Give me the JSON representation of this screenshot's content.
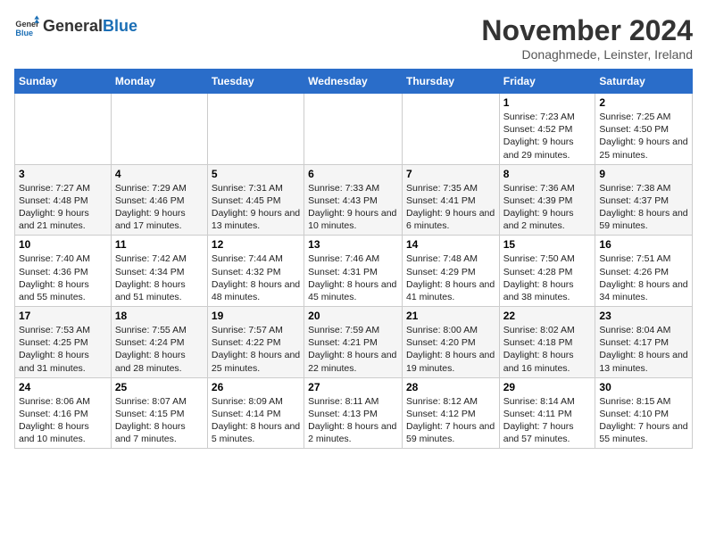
{
  "header": {
    "logo_general": "General",
    "logo_blue": "Blue",
    "month_title": "November 2024",
    "location": "Donaghmede, Leinster, Ireland"
  },
  "weekdays": [
    "Sunday",
    "Monday",
    "Tuesday",
    "Wednesday",
    "Thursday",
    "Friday",
    "Saturday"
  ],
  "weeks": [
    [
      {
        "day": "",
        "info": ""
      },
      {
        "day": "",
        "info": ""
      },
      {
        "day": "",
        "info": ""
      },
      {
        "day": "",
        "info": ""
      },
      {
        "day": "",
        "info": ""
      },
      {
        "day": "1",
        "info": "Sunrise: 7:23 AM\nSunset: 4:52 PM\nDaylight: 9 hours\nand 29 minutes."
      },
      {
        "day": "2",
        "info": "Sunrise: 7:25 AM\nSunset: 4:50 PM\nDaylight: 9 hours\nand 25 minutes."
      }
    ],
    [
      {
        "day": "3",
        "info": "Sunrise: 7:27 AM\nSunset: 4:48 PM\nDaylight: 9 hours\nand 21 minutes."
      },
      {
        "day": "4",
        "info": "Sunrise: 7:29 AM\nSunset: 4:46 PM\nDaylight: 9 hours\nand 17 minutes."
      },
      {
        "day": "5",
        "info": "Sunrise: 7:31 AM\nSunset: 4:45 PM\nDaylight: 9 hours\nand 13 minutes."
      },
      {
        "day": "6",
        "info": "Sunrise: 7:33 AM\nSunset: 4:43 PM\nDaylight: 9 hours\nand 10 minutes."
      },
      {
        "day": "7",
        "info": "Sunrise: 7:35 AM\nSunset: 4:41 PM\nDaylight: 9 hours\nand 6 minutes."
      },
      {
        "day": "8",
        "info": "Sunrise: 7:36 AM\nSunset: 4:39 PM\nDaylight: 9 hours\nand 2 minutes."
      },
      {
        "day": "9",
        "info": "Sunrise: 7:38 AM\nSunset: 4:37 PM\nDaylight: 8 hours\nand 59 minutes."
      }
    ],
    [
      {
        "day": "10",
        "info": "Sunrise: 7:40 AM\nSunset: 4:36 PM\nDaylight: 8 hours\nand 55 minutes."
      },
      {
        "day": "11",
        "info": "Sunrise: 7:42 AM\nSunset: 4:34 PM\nDaylight: 8 hours\nand 51 minutes."
      },
      {
        "day": "12",
        "info": "Sunrise: 7:44 AM\nSunset: 4:32 PM\nDaylight: 8 hours\nand 48 minutes."
      },
      {
        "day": "13",
        "info": "Sunrise: 7:46 AM\nSunset: 4:31 PM\nDaylight: 8 hours\nand 45 minutes."
      },
      {
        "day": "14",
        "info": "Sunrise: 7:48 AM\nSunset: 4:29 PM\nDaylight: 8 hours\nand 41 minutes."
      },
      {
        "day": "15",
        "info": "Sunrise: 7:50 AM\nSunset: 4:28 PM\nDaylight: 8 hours\nand 38 minutes."
      },
      {
        "day": "16",
        "info": "Sunrise: 7:51 AM\nSunset: 4:26 PM\nDaylight: 8 hours\nand 34 minutes."
      }
    ],
    [
      {
        "day": "17",
        "info": "Sunrise: 7:53 AM\nSunset: 4:25 PM\nDaylight: 8 hours\nand 31 minutes."
      },
      {
        "day": "18",
        "info": "Sunrise: 7:55 AM\nSunset: 4:24 PM\nDaylight: 8 hours\nand 28 minutes."
      },
      {
        "day": "19",
        "info": "Sunrise: 7:57 AM\nSunset: 4:22 PM\nDaylight: 8 hours\nand 25 minutes."
      },
      {
        "day": "20",
        "info": "Sunrise: 7:59 AM\nSunset: 4:21 PM\nDaylight: 8 hours\nand 22 minutes."
      },
      {
        "day": "21",
        "info": "Sunrise: 8:00 AM\nSunset: 4:20 PM\nDaylight: 8 hours\nand 19 minutes."
      },
      {
        "day": "22",
        "info": "Sunrise: 8:02 AM\nSunset: 4:18 PM\nDaylight: 8 hours\nand 16 minutes."
      },
      {
        "day": "23",
        "info": "Sunrise: 8:04 AM\nSunset: 4:17 PM\nDaylight: 8 hours\nand 13 minutes."
      }
    ],
    [
      {
        "day": "24",
        "info": "Sunrise: 8:06 AM\nSunset: 4:16 PM\nDaylight: 8 hours\nand 10 minutes."
      },
      {
        "day": "25",
        "info": "Sunrise: 8:07 AM\nSunset: 4:15 PM\nDaylight: 8 hours\nand 7 minutes."
      },
      {
        "day": "26",
        "info": "Sunrise: 8:09 AM\nSunset: 4:14 PM\nDaylight: 8 hours\nand 5 minutes."
      },
      {
        "day": "27",
        "info": "Sunrise: 8:11 AM\nSunset: 4:13 PM\nDaylight: 8 hours\nand 2 minutes."
      },
      {
        "day": "28",
        "info": "Sunrise: 8:12 AM\nSunset: 4:12 PM\nDaylight: 7 hours\nand 59 minutes."
      },
      {
        "day": "29",
        "info": "Sunrise: 8:14 AM\nSunset: 4:11 PM\nDaylight: 7 hours\nand 57 minutes."
      },
      {
        "day": "30",
        "info": "Sunrise: 8:15 AM\nSunset: 4:10 PM\nDaylight: 7 hours\nand 55 minutes."
      }
    ]
  ]
}
